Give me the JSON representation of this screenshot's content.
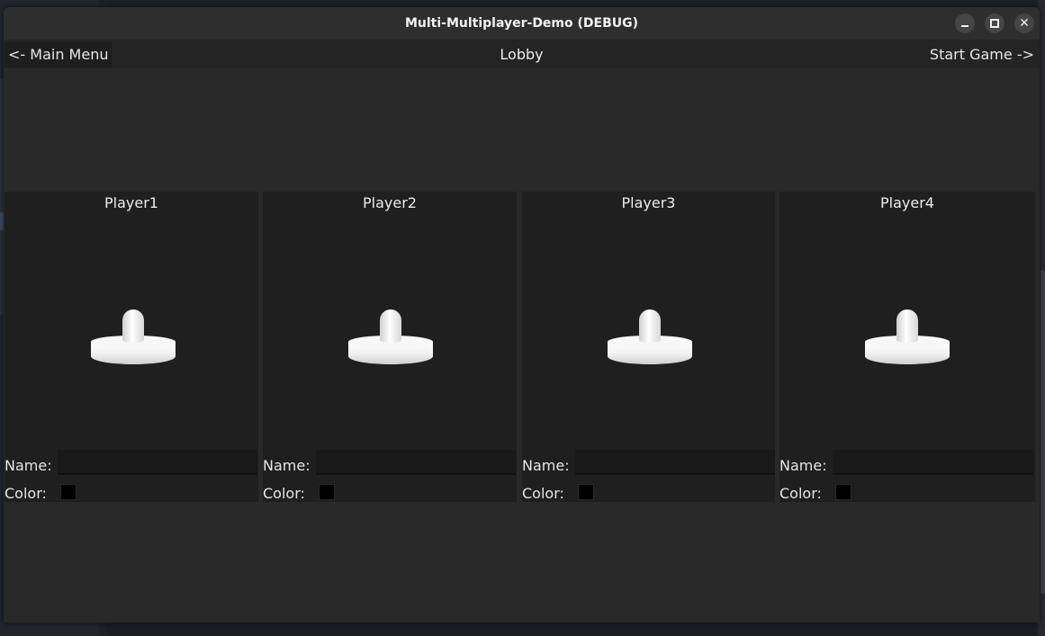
{
  "window": {
    "title": "Multi-Multiplayer-Demo (DEBUG)"
  },
  "topbar": {
    "back_label": "<- Main Menu",
    "title": "Lobby",
    "start_label": "Start Game ->"
  },
  "slots": [
    {
      "player": "Player1",
      "name_label": "Name:",
      "name_value": "",
      "color_label": "Color:",
      "color": "#000000"
    },
    {
      "player": "Player2",
      "name_label": "Name:",
      "name_value": "",
      "color_label": "Color:",
      "color": "#000000"
    },
    {
      "player": "Player3",
      "name_label": "Name:",
      "name_value": "",
      "color_label": "Color:",
      "color": "#000000"
    },
    {
      "player": "Player4",
      "name_label": "Name:",
      "name_value": "",
      "color_label": "Color:",
      "color": "#000000"
    }
  ],
  "theme": {
    "panel_bg": "#1f1f1f",
    "window_bg": "#282828",
    "player_model": "white-pawn-model"
  }
}
